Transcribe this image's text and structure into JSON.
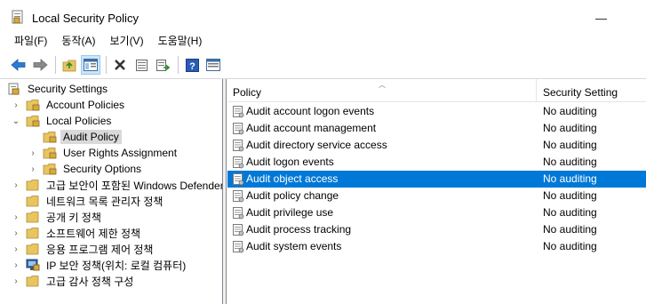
{
  "window": {
    "title": "Local Security Policy"
  },
  "menu": [
    "파일(F)",
    "동작(A)",
    "보기(V)",
    "도움말(H)"
  ],
  "toolbar": {
    "buttons": [
      {
        "name": "back-arrow-icon"
      },
      {
        "name": "forward-arrow-icon"
      },
      {
        "name": "up-folder-icon"
      },
      {
        "name": "show-hide-tree-icon"
      },
      {
        "name": "delete-icon"
      },
      {
        "name": "properties-icon"
      },
      {
        "name": "export-list-icon"
      },
      {
        "name": "help-icon"
      },
      {
        "name": "extended-view-icon"
      }
    ]
  },
  "tree": {
    "root": "Security Settings",
    "items": [
      {
        "label": "Account Policies",
        "expander": "›"
      },
      {
        "label": "Local Policies",
        "expander": "⌄"
      },
      {
        "label": "Audit Policy",
        "expander": ""
      },
      {
        "label": "User Rights Assignment",
        "expander": "›"
      },
      {
        "label": "Security Options",
        "expander": "›"
      },
      {
        "label": "고급 보안이 포함된 Windows Defender 방화벽",
        "expander": "›"
      },
      {
        "label": "네트워크 목록 관리자 정책",
        "expander": ""
      },
      {
        "label": "공개 키 정책",
        "expander": "›"
      },
      {
        "label": "소프트웨어 제한 정책",
        "expander": "›"
      },
      {
        "label": "응용 프로그램 제어 정책",
        "expander": "›"
      },
      {
        "label": "IP 보안 정책(위치: 로컬 컴퓨터)",
        "expander": "›"
      },
      {
        "label": "고급 감사 정책 구성",
        "expander": "›"
      }
    ]
  },
  "list": {
    "columns": {
      "policy": "Policy",
      "setting": "Security Setting"
    },
    "rows": [
      {
        "policy": "Audit account logon events",
        "setting": "No auditing"
      },
      {
        "policy": "Audit account management",
        "setting": "No auditing"
      },
      {
        "policy": "Audit directory service access",
        "setting": "No auditing"
      },
      {
        "policy": "Audit logon events",
        "setting": "No auditing"
      },
      {
        "policy": "Audit object access",
        "setting": "No auditing"
      },
      {
        "policy": "Audit policy change",
        "setting": "No auditing"
      },
      {
        "policy": "Audit privilege use",
        "setting": "No auditing"
      },
      {
        "policy": "Audit process tracking",
        "setting": "No auditing"
      },
      {
        "policy": "Audit system events",
        "setting": "No auditing"
      }
    ],
    "selected_index": 4
  },
  "colors": {
    "selection": "#0078d7",
    "folder": "#e8c463"
  }
}
